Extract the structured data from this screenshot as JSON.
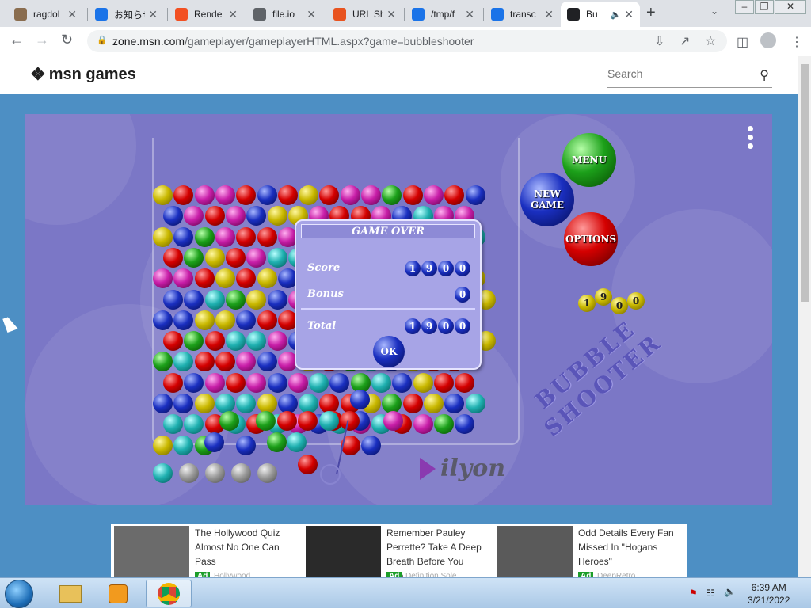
{
  "browser": {
    "tabs": [
      {
        "title": "ragdol",
        "icon": "cat-photo-icon",
        "color": "#8a6d4f"
      },
      {
        "title": "お知らせ",
        "icon": "command-icon",
        "color": "#1a73e8"
      },
      {
        "title": "Rende",
        "icon": "windows-logo-icon",
        "color": "#f25022"
      },
      {
        "title": "file.io",
        "icon": "globe-icon",
        "color": "#5f6368"
      },
      {
        "title": "URL Sh",
        "icon": "b-logo-icon",
        "color": "#e8531f"
      },
      {
        "title": "/tmp/f",
        "icon": "cloud-icon",
        "color": "#1a73e8"
      },
      {
        "title": "transc",
        "icon": "cloud-icon",
        "color": "#1a73e8"
      },
      {
        "title": "Bu",
        "icon": "butterfly-icon",
        "color": "#202124",
        "active": true
      }
    ],
    "url_host": "zone.msn.com",
    "url_path": "/gameplayer/gameplayerHTML.aspx?game=bubbleshooter"
  },
  "msn": {
    "logo_text": "msn games",
    "search_placeholder": "Search"
  },
  "game": {
    "dialog": {
      "title": "GAME OVER",
      "score_label": "Score",
      "score_value": "1900",
      "bonus_label": "Bonus",
      "bonus_value": "0",
      "total_label": "Total",
      "total_value": "1900",
      "ok_label": "OK"
    },
    "buttons": {
      "menu": "MENU",
      "new_game": "NEW GAME",
      "options": "OPTIONS"
    },
    "score_balls": "1900",
    "logo_text": "BUBBLE SHOOTER",
    "brand": "ilyon",
    "grid": [
      "yrmmrbryrmmgrmrb",
      "bmrmbyymrrmbcmm",
      "ybgmrrmrrgrmrrgc",
      "rgyrmccyrbybggc",
      "mmryrybmyyyrcryy",
      "bbcgybmbyrrcmgry",
      "bbyybrrmrgbybrg",
      "rgrccmbcyycyrmby",
      "gcrrmbmyrgcbyrr",
      "rbmrmbmcbgcbyrr",
      "bbyccybcrrygrybc",
      "ccrcrcmbcmcrmgb",
      "ycg b    rb",
      "",
      ""
    ],
    "next_queue": [
      "c",
      "gr",
      "gr",
      "gr",
      "gr"
    ]
  },
  "ads": [
    {
      "text": "The Hollywood Quiz Almost No One Can Pass",
      "tag": "Ad",
      "source": "Hollywood"
    },
    {
      "text": "Remember Pauley Perrette? Take A Deep Breath Before You See...",
      "tag": "Ad",
      "source": "Definition Sole"
    },
    {
      "text": "Odd Details Every Fan Missed In \"Hogans Heroes\"",
      "tag": "Ad",
      "source": "DeepRetro"
    }
  ],
  "taskbar": {
    "time": "6:39 AM",
    "date": "3/21/2022"
  }
}
